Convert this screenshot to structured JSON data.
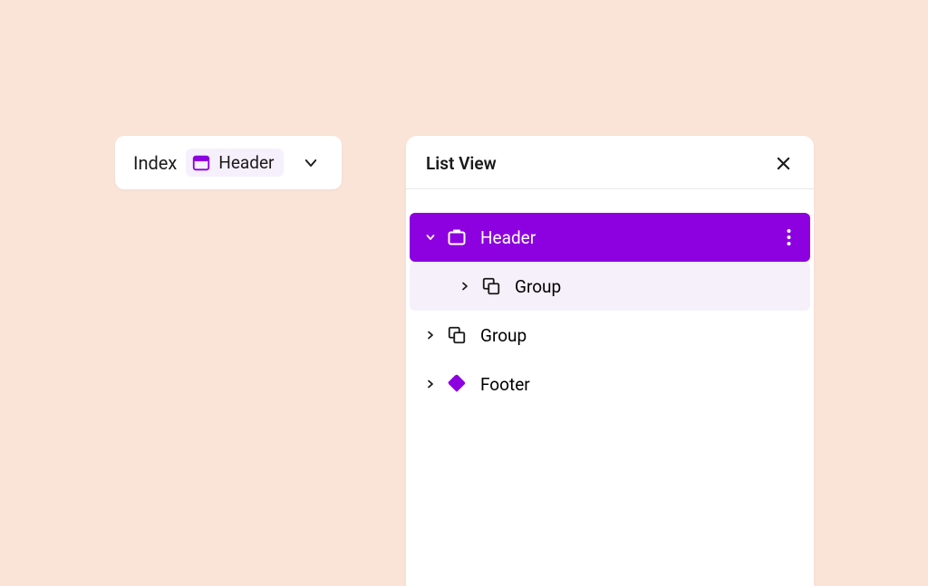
{
  "breadcrumb": {
    "root_label": "Index",
    "chip_label": "Header",
    "chip_icon": "header-template-icon"
  },
  "panel": {
    "title": "List View"
  },
  "tree": {
    "items": [
      {
        "label": "Header",
        "icon": "header-block-icon",
        "expanded": true,
        "selected": true,
        "level": 0
      },
      {
        "label": "Group",
        "icon": "group-icon",
        "expanded": false,
        "selected": false,
        "hover": true,
        "level": 1
      },
      {
        "label": "Group",
        "icon": "group-icon",
        "expanded": false,
        "selected": false,
        "level": 0
      },
      {
        "label": "Footer",
        "icon": "footer-block-icon",
        "expanded": false,
        "selected": false,
        "level": 0
      }
    ]
  },
  "colors": {
    "accent": "#8d00e0",
    "background": "#fae4d7",
    "surface": "#ffffff",
    "hover": "#f6f0fb"
  }
}
